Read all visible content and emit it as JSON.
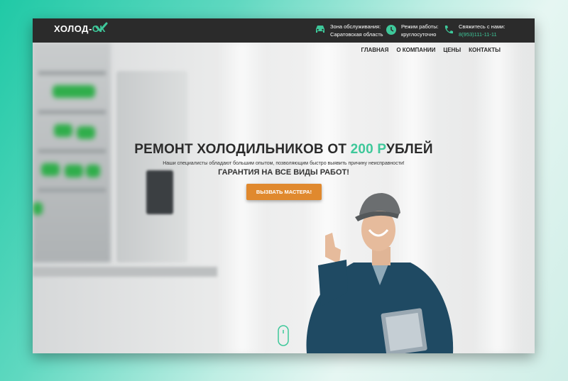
{
  "logo": {
    "text_main": "ХОЛОД-",
    "text_accent": "ОК"
  },
  "header": {
    "service": {
      "label": "Зона обслуживания:",
      "value": "Саратовская область"
    },
    "hours": {
      "label": "Режим работы:",
      "value": "круглосуточно"
    },
    "contact": {
      "label": "Свяжитесь с нами:",
      "phone": "8(953)111-11-11"
    }
  },
  "nav": {
    "items": [
      "ГЛАВНАЯ",
      "О КОМПАНИИ",
      "ЦЕНЫ",
      "КОНТАКТЫ"
    ]
  },
  "hero": {
    "title_before": "РЕМОНТ ХОЛОДИЛЬНИКОВ ОТ ",
    "title_number": "200 Р",
    "title_after": "УБЛЕЙ",
    "subtitle": "Наши специалисты обладают большим опытом, позволяющим быстро выявить причину неисправности!",
    "guarantee": "ГАРАНТИЯ НА ВСЕ ВИДЫ РАБОТ!",
    "cta_label": "ВЫЗВАТЬ МАСТЕРА!"
  },
  "colors": {
    "accent": "#3ec89a",
    "cta": "#e0892e",
    "header_bg": "#2b2b2b"
  },
  "icons": [
    "check-icon",
    "car-icon",
    "clock-icon",
    "phone-icon",
    "scroll-mouse-icon"
  ]
}
